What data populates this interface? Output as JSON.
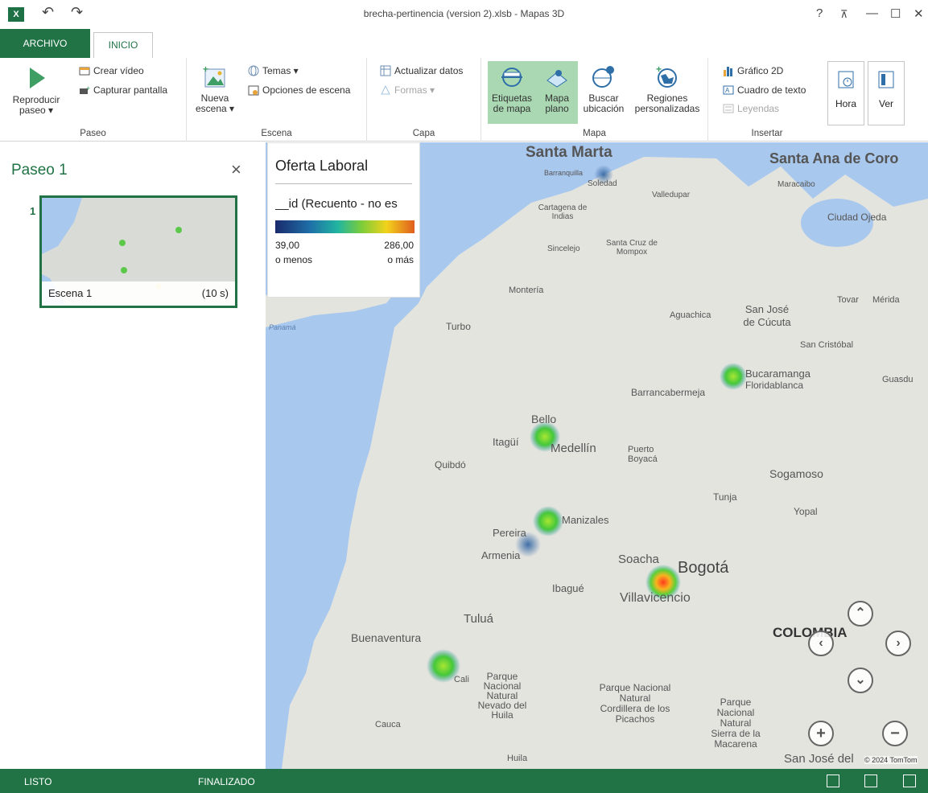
{
  "window": {
    "title": "brecha-pertinencia (version 2).xlsb - Mapas 3D",
    "help": "?",
    "controls": [
      "—",
      "☐",
      "✕"
    ]
  },
  "tabs": {
    "file": "ARCHIVO",
    "home": "INICIO"
  },
  "ribbon": {
    "paseo": {
      "label": "Paseo",
      "play": "Reproducir paseo ▾",
      "create_video": "Crear vídeo",
      "capture": "Capturar pantalla"
    },
    "escena": {
      "label": "Escena",
      "new_scene": "Nueva escena ▾",
      "themes": "Temas ▾",
      "scene_options": "Opciones de escena"
    },
    "capa": {
      "label": "Capa",
      "refresh": "Actualizar datos",
      "shapes": "Formas ▾"
    },
    "mapa": {
      "label": "Mapa",
      "labels": "Etiquetas de mapa",
      "flat": "Mapa plano",
      "find": "Buscar ubicación",
      "regions": "Regiones personalizadas"
    },
    "insertar": {
      "label": "Insertar",
      "chart2d": "Gráfico 2D",
      "textbox": "Cuadro de texto",
      "legends": "Leyendas"
    },
    "time": "Hora",
    "view": "Ver"
  },
  "tour_panel": {
    "title": "Paseo 1",
    "close": "×",
    "scene_number": "1",
    "scene_name": "Escena 1",
    "scene_duration": "(10 s)"
  },
  "legend": {
    "title": "Oferta Laboral",
    "field": "__id (Recuento - no es",
    "min_value": "39,00",
    "max_value": "286,00",
    "min_label": "o menos",
    "max_label": "o más"
  },
  "map": {
    "places": {
      "santa_marta": "Santa Marta",
      "santa_ana": "Santa Ana de Coro",
      "barranquilla": "Barranquilla",
      "soledad": "Soledad",
      "valledupar": "Valledupar",
      "maracaibo": "Maracaibo",
      "ciudad_ojeda": "Ciudad Ojeda",
      "cartagena": "Cartagena de Indias",
      "sincelejo": "Sincelejo",
      "mompox": "Santa Cruz de Mompox",
      "monteria": "Montería",
      "aguachica": "Aguachica",
      "cucuta": "San José de Cúcuta",
      "tovar": "Tovar",
      "merida": "Mérida",
      "san_cristobal": "San Cristóbal",
      "turbo": "Turbo",
      "panama": "Panamá",
      "bucaramanga": "Bucaramanga",
      "floridablanca": "Floridablanca",
      "barrancabermeja": "Barrancabermeja",
      "guasdualito": "Guasdu",
      "bello": "Bello",
      "itagui": "Itagüí",
      "medellin": "Medellín",
      "puerto_boyaca": "Puerto Boyacá",
      "quibdo": "Quibdó",
      "sogamoso": "Sogamoso",
      "tunja": "Tunja",
      "yopal": "Yopal",
      "manizales": "Manizales",
      "pereira": "Pereira",
      "armenia": "Armenia",
      "soacha": "Soacha",
      "bogota": "Bogotá",
      "ibague": "Ibagué",
      "villavicencio": "Villavicencio",
      "tulua": "Tuluá",
      "buenaventura": "Buenaventura",
      "colombia": "COLOMBIA",
      "cali": "Cali",
      "parque1": "Parque Nacional Natural Nevado del Huila",
      "parque2": "Parque Nacional Natural Cordillera de los Picachos",
      "parque3": "Parque Nacional Natural Sierra de la Macarena",
      "huila": "Huila",
      "cauca": "Cauca",
      "san_jose": "San José del"
    },
    "hotspots": [
      {
        "city": "Barranquilla",
        "count": 90
      },
      {
        "city": "Bucaramanga",
        "count": 150
      },
      {
        "city": "Medellín",
        "count": 160
      },
      {
        "city": "Manizales",
        "count": 150
      },
      {
        "city": "Armenia",
        "count": 50
      },
      {
        "city": "Bogotá",
        "count": 286
      },
      {
        "city": "Cali",
        "count": 140
      }
    ],
    "copyright": "© 2024 TomTom"
  },
  "status": {
    "ready": "LISTO",
    "done": "FINALIZADO"
  }
}
